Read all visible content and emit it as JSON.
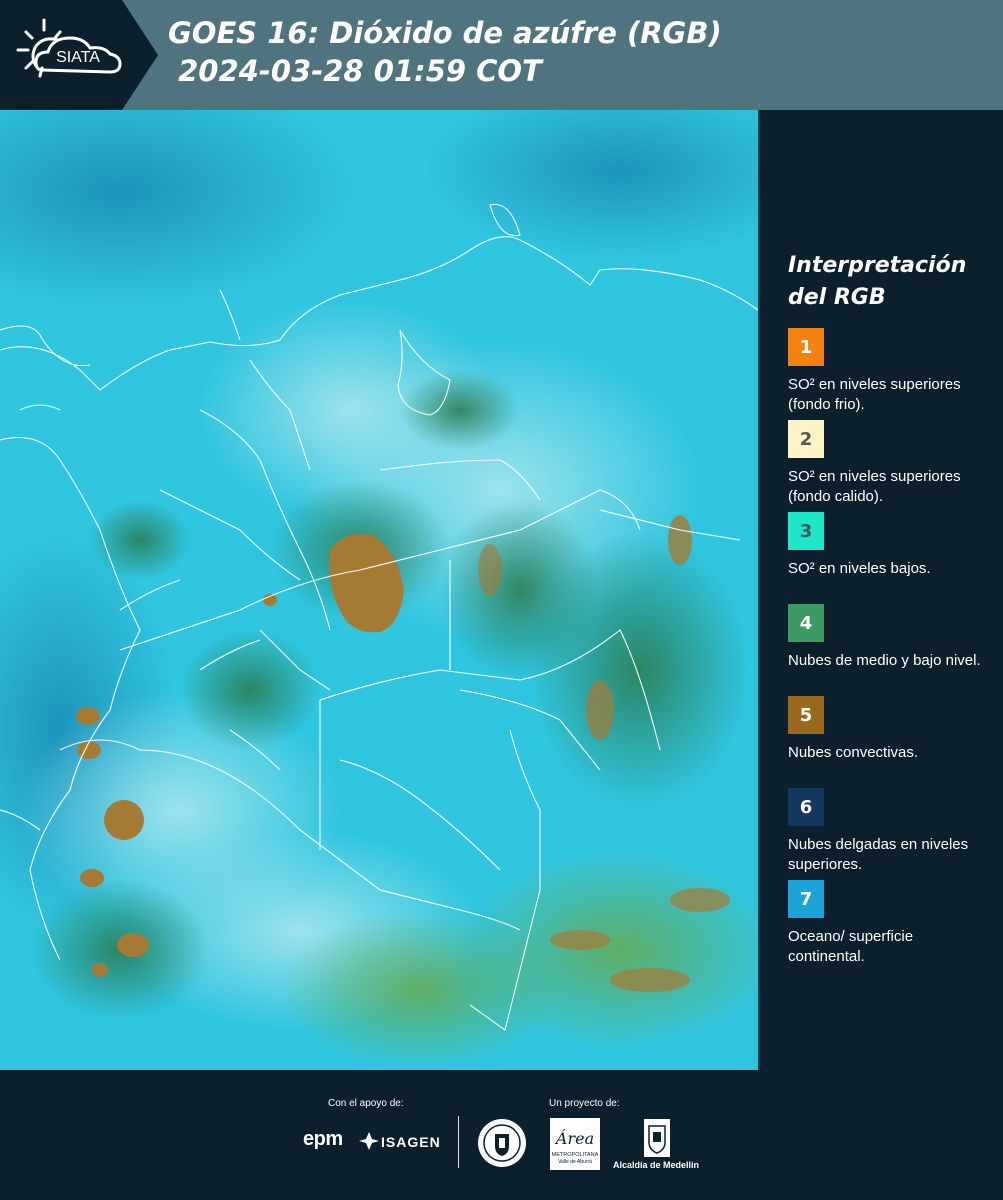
{
  "header": {
    "logo_text": "SIATA",
    "title_line1": "GOES 16: Dióxido de azúfre (RGB)",
    "title_line2": " 2024-03-28 01:59 COT"
  },
  "legend": {
    "title_line1": "Interpretación",
    "title_line2": "del RGB",
    "items": [
      {
        "number": "1",
        "color": "#f5820f",
        "number_color": "#ffffff",
        "desc": "SO² en niveles superiores (fondo frio)."
      },
      {
        "number": "2",
        "color": "#fcf4c4",
        "number_color": "#555555",
        "desc": "SO² en niveles superiores (fondo calido)."
      },
      {
        "number": "3",
        "color": "#20e6c8",
        "number_color": "#3d5c5a",
        "desc": "SO² en niveles bajos."
      },
      {
        "number": "4",
        "color": "#3e9a63",
        "number_color": "#ffffff",
        "desc": "Nubes de medio y bajo nivel."
      },
      {
        "number": "5",
        "color": "#986a1c",
        "number_color": "#ffffff",
        "desc": "Nubes convectivas."
      },
      {
        "number": "6",
        "color": "#13375f",
        "number_color": "#ffffff",
        "desc": "Nubes delgadas en niveles superiores."
      },
      {
        "number": "7",
        "color": "#1ba5d6",
        "number_color": "#ffffff",
        "desc": "Oceano/ superficie continental."
      }
    ]
  },
  "footer": {
    "support_label": "Con el apoyo de:",
    "project_label": "Un proyecto de:",
    "epm": "epm",
    "isagen": "ISAGEN",
    "area_title": "Área",
    "area_sub1": "METROPOLITANA",
    "area_sub2": "Valle de Aburrá",
    "alcaldia": "Alcaldía de Medellín"
  },
  "colors": {
    "header_bg": "#4f7480",
    "panel_bg": "#0c1f2c",
    "map_base": "#2ec6e0"
  }
}
